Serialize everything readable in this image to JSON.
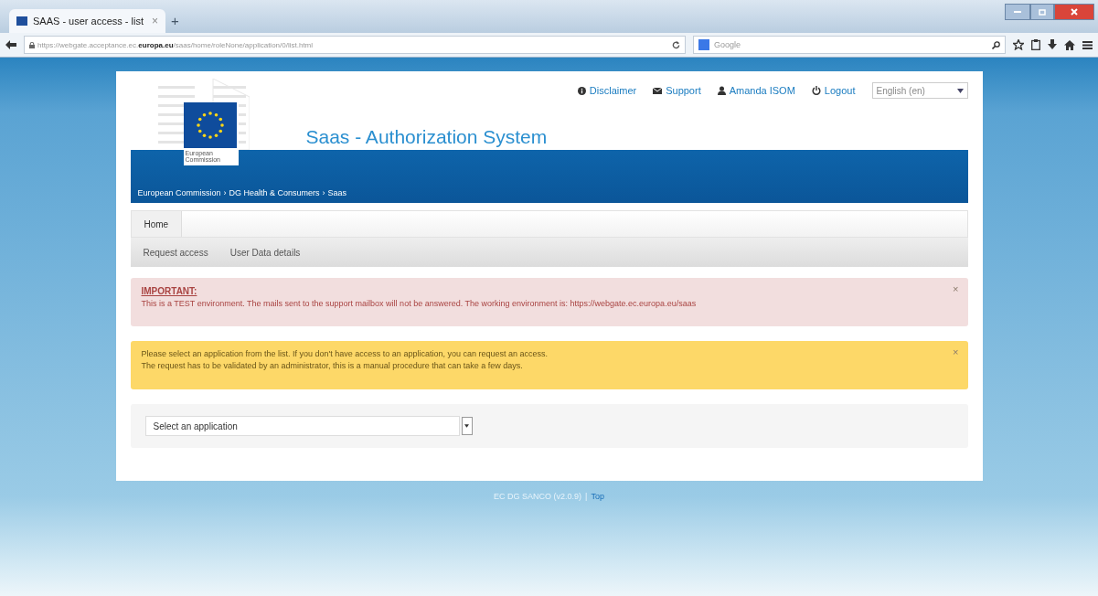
{
  "browser": {
    "tab_title": "SAAS - user access - list",
    "tab_close": "×",
    "new_tab": "+",
    "url_prefix": "https://webgate.acceptance.ec.",
    "url_domain": "europa.eu",
    "url_path": "/saas/home/roleNone/application/0/list.html",
    "search_placeholder": "Google"
  },
  "header": {
    "logo_text": "European Commission",
    "title": "Saas - Authorization System",
    "top_links": [
      {
        "kind": "info",
        "label": "Disclaimer"
      },
      {
        "kind": "mail",
        "label": "Support"
      },
      {
        "kind": "user",
        "label": "Amanda ISOM"
      },
      {
        "kind": "power",
        "label": "Logout"
      }
    ],
    "language": "English (en)",
    "breadcrumb": [
      "European Commission",
      "DG Health & Consumers",
      "Saas"
    ],
    "breadcrumb_separator": "›"
  },
  "tabs": [
    {
      "label": "Home",
      "selected": true
    }
  ],
  "subnav": [
    "Request access",
    "User Data details"
  ],
  "alerts": [
    {
      "kind": "danger",
      "title": "IMPORTANT:",
      "lines": [
        "This is a TEST environment. The mails sent to the support mailbox will not be answered. The working environment is: https://webgate.ec.europa.eu/saas"
      ],
      "close": "×"
    },
    {
      "kind": "warning",
      "lines": [
        "Please select an application from the list. If you don't have access to an application, you can request an access.",
        "The request has to be validated by an administrator, this is a manual procedure that can take a few days."
      ],
      "close": "×"
    }
  ],
  "application_select": {
    "placeholder": "Select an application"
  },
  "footer": {
    "version": "EC DG SANCO (v2.0.9)",
    "separator": "|",
    "top_link": "Top"
  }
}
